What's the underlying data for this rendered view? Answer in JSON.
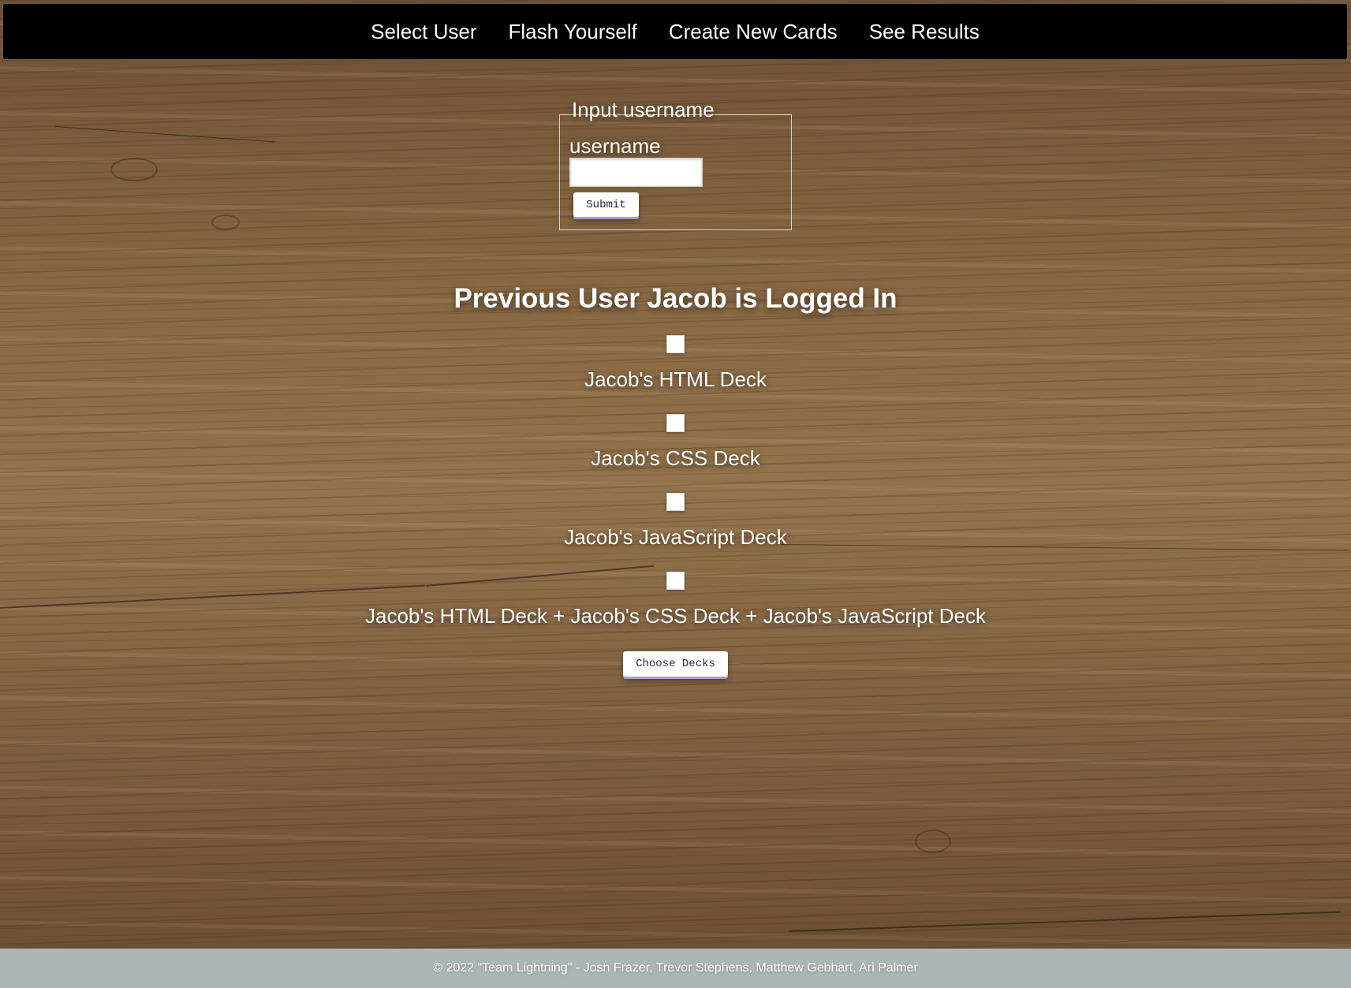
{
  "nav": {
    "items": [
      {
        "label": "Select User"
      },
      {
        "label": "Flash Yourself"
      },
      {
        "label": "Create New Cards"
      },
      {
        "label": "See Results"
      }
    ]
  },
  "login_form": {
    "legend": "Input username",
    "field_label": "username",
    "input_value": "",
    "submit_label": "Submit"
  },
  "previous_user": {
    "heading": "Previous User Jacob is Logged In",
    "decks": [
      {
        "label": "Jacob's HTML Deck",
        "checked": false
      },
      {
        "label": "Jacob's CSS Deck",
        "checked": false
      },
      {
        "label": "Jacob's JavaScript Deck",
        "checked": false
      },
      {
        "label": "Jacob's HTML Deck + Jacob's CSS Deck + Jacob's JavaScript Deck",
        "checked": false
      }
    ],
    "choose_label": "Choose Decks"
  },
  "footer": {
    "text": "© 2022 \"Team Lightning\" - Josh Frazer, Trevor Stephens, Matthew Gebhart, Ari Palmer"
  },
  "colors": {
    "navbar": "#000000",
    "footer": "#abb7b4",
    "button_text": "#2b2446"
  }
}
